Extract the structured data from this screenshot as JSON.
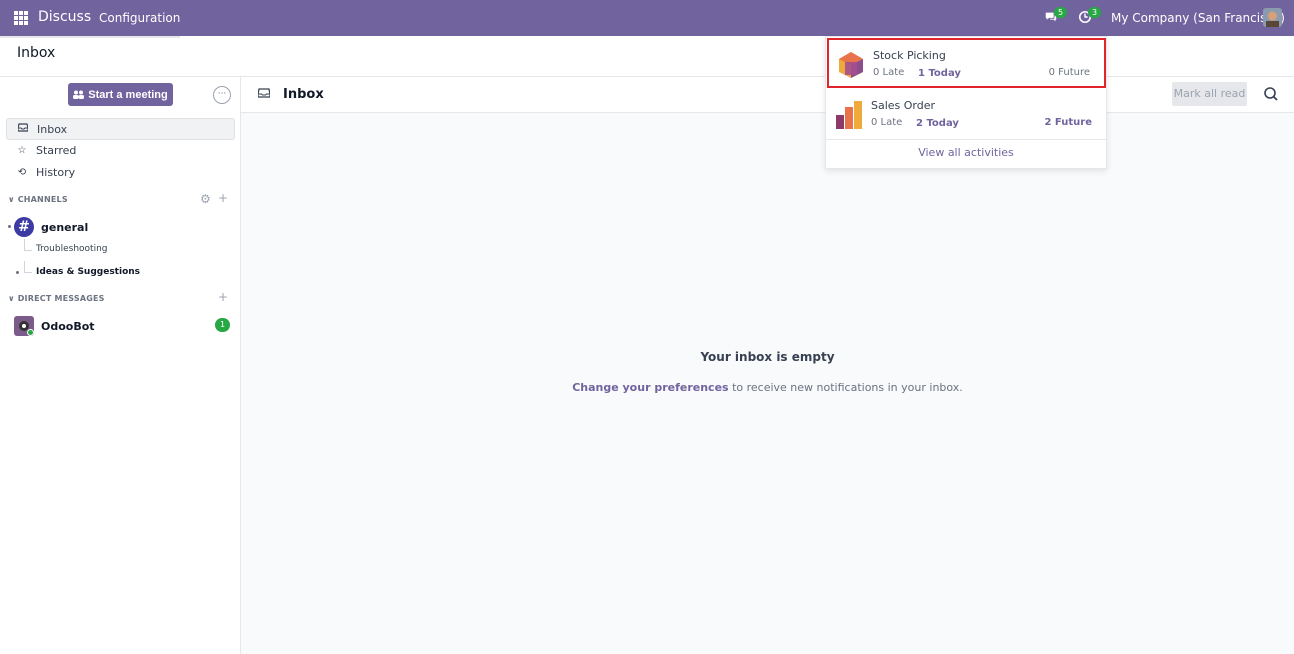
{
  "navbar": {
    "app_name": "Discuss",
    "menu_config": "Configuration",
    "messages_count": "5",
    "activities_count": "3",
    "company": "My Company (San Francisco)"
  },
  "control_panel": {
    "title": "Inbox"
  },
  "sidebar": {
    "start_meeting": "Start a meeting",
    "nav": [
      {
        "label": "Inbox",
        "icon": "inbox-icon"
      },
      {
        "label": "Starred",
        "icon": "star-icon"
      },
      {
        "label": "History",
        "icon": "history-icon"
      }
    ],
    "channels_header": "CHANNELS",
    "channel": "general",
    "sub_channels": [
      "Troubleshooting",
      "Ideas & Suggestions"
    ],
    "dm_header": "DIRECT MESSAGES",
    "dm": {
      "name": "OdooBot",
      "unread": "1"
    }
  },
  "thread": {
    "title": "Inbox",
    "mark_all_read": "Mark all read",
    "empty_title": "Your inbox is empty",
    "empty_link": "Change your preferences",
    "empty_text": " to receive new notifications in your inbox."
  },
  "activities": {
    "items": [
      {
        "name": "Stock Picking",
        "late": "0 Late",
        "today": "1 Today",
        "future": "0 Future"
      },
      {
        "name": "Sales Order",
        "late": "0 Late",
        "today": "2 Today",
        "future": "2 Future"
      }
    ],
    "view_all": "View all activities"
  },
  "colors": {
    "brand": "#71639e",
    "badge": "#28a745",
    "highlight": "#e0252b"
  }
}
